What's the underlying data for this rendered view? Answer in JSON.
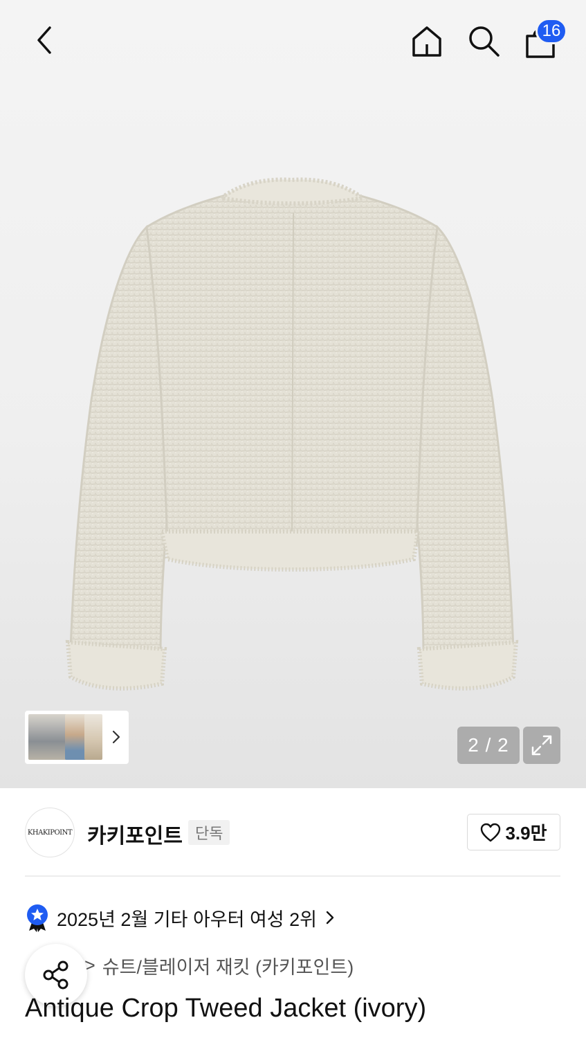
{
  "header": {
    "back_icon": "chevron-left-icon",
    "home_icon": "home-icon",
    "search_icon": "search-icon",
    "cart_icon": "shopping-bag-icon",
    "cart_count": "16"
  },
  "gallery": {
    "counter": "2 / 2",
    "expand_icon": "expand-icon",
    "thumbnail_arrow_icon": "chevron-right-icon"
  },
  "brand": {
    "logo_text": "KHAKIPOINT",
    "name": "카키포인트",
    "tag": "단독",
    "likes": "3.9만"
  },
  "ranking": {
    "text": "2025년 2월 기타 아우터 여성 2위",
    "icon": "ranking-badge-icon"
  },
  "category": {
    "separator": ">",
    "path": "슈트/블레이저 재킷 (카키포인트)"
  },
  "product": {
    "title": "Antique Crop Tweed Jacket (ivory)"
  },
  "colors": {
    "accent": "#1f5cf2",
    "jacket": "#e6e3d9"
  }
}
